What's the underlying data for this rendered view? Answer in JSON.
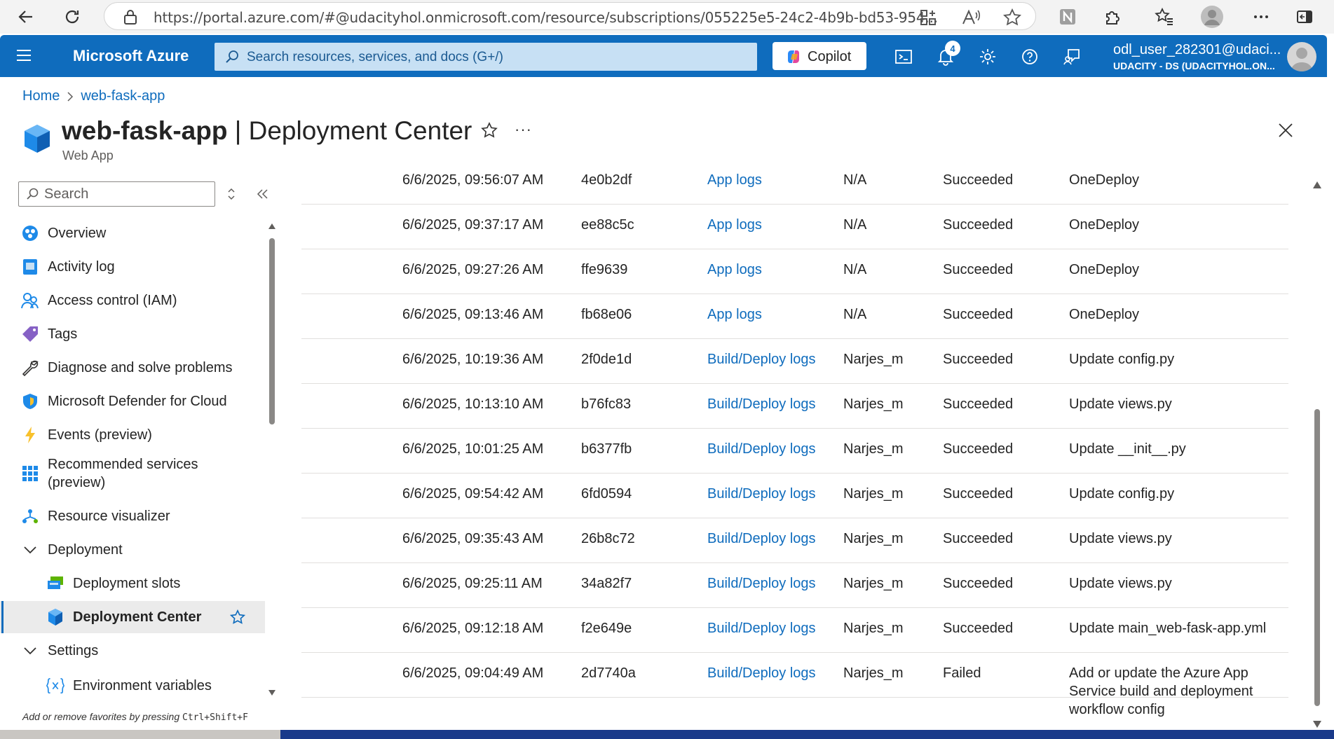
{
  "browser": {
    "url": "https://portal.azure.com/#@udacityhol.onmicrosoft.com/resource/subscriptions/055225e5-24c2-4b9b-bd53-954..."
  },
  "topbar": {
    "brand": "Microsoft Azure",
    "search_placeholder": "Search resources, services, and docs (G+/)",
    "copilot_label": "Copilot",
    "notification_count": "4",
    "user_name": "odl_user_282301@udaci...",
    "user_org": "UDACITY - DS (UDACITYHOL.ON..."
  },
  "breadcrumb": {
    "home": "Home",
    "resource": "web-fask-app"
  },
  "header": {
    "resource_name": "web-fask-app",
    "separator": " | ",
    "page_name": "Deployment Center",
    "subtitle": "Web App",
    "more": "···"
  },
  "sidebar": {
    "search_placeholder": "Search",
    "items": [
      {
        "label": "Overview",
        "icon": "overview-icon"
      },
      {
        "label": "Activity log",
        "icon": "activity-log-icon"
      },
      {
        "label": "Access control (IAM)",
        "icon": "iam-icon"
      },
      {
        "label": "Tags",
        "icon": "tag-icon"
      },
      {
        "label": "Diagnose and solve problems",
        "icon": "wrench-icon"
      },
      {
        "label": "Microsoft Defender for Cloud",
        "icon": "shield-icon"
      },
      {
        "label": "Events (preview)",
        "icon": "lightning-icon"
      },
      {
        "label": "Recommended services (preview)",
        "icon": "grid-icon"
      },
      {
        "label": "Resource visualizer",
        "icon": "visualizer-icon"
      },
      {
        "label": "Deployment",
        "icon": "chevron-down-icon"
      },
      {
        "label": "Deployment slots",
        "icon": "slots-icon"
      },
      {
        "label": "Deployment Center",
        "icon": "cube-icon"
      },
      {
        "label": "Settings",
        "icon": "chevron-down-icon"
      },
      {
        "label": "Environment variables",
        "icon": "variable-icon"
      }
    ],
    "fav_hint_prefix": "Add or remove favorites by pressing ",
    "fav_hint_keys": "Ctrl+Shift+F"
  },
  "deployments": [
    {
      "time": "6/6/2025, 09:56:07 AM",
      "commit": "4e0b2df",
      "logs": "App logs",
      "author": "N/A",
      "status": "Succeeded",
      "message": "OneDeploy"
    },
    {
      "time": "6/6/2025, 09:37:17 AM",
      "commit": "ee88c5c",
      "logs": "App logs",
      "author": "N/A",
      "status": "Succeeded",
      "message": "OneDeploy"
    },
    {
      "time": "6/6/2025, 09:27:26 AM",
      "commit": "ffe9639",
      "logs": "App logs",
      "author": "N/A",
      "status": "Succeeded",
      "message": "OneDeploy"
    },
    {
      "time": "6/6/2025, 09:13:46 AM",
      "commit": "fb68e06",
      "logs": "App logs",
      "author": "N/A",
      "status": "Succeeded",
      "message": "OneDeploy"
    },
    {
      "time": "6/6/2025, 10:19:36 AM",
      "commit": "2f0de1d",
      "logs": "Build/Deploy logs",
      "author": "Narjes_m",
      "status": "Succeeded",
      "message": "Update config.py"
    },
    {
      "time": "6/6/2025, 10:13:10 AM",
      "commit": "b76fc83",
      "logs": "Build/Deploy logs",
      "author": "Narjes_m",
      "status": "Succeeded",
      "message": "Update views.py"
    },
    {
      "time": "6/6/2025, 10:01:25 AM",
      "commit": "b6377fb",
      "logs": "Build/Deploy logs",
      "author": "Narjes_m",
      "status": "Succeeded",
      "message": "Update __init__.py"
    },
    {
      "time": "6/6/2025, 09:54:42 AM",
      "commit": "6fd0594",
      "logs": "Build/Deploy logs",
      "author": "Narjes_m",
      "status": "Succeeded",
      "message": "Update config.py"
    },
    {
      "time": "6/6/2025, 09:35:43 AM",
      "commit": "26b8c72",
      "logs": "Build/Deploy logs",
      "author": "Narjes_m",
      "status": "Succeeded",
      "message": "Update views.py"
    },
    {
      "time": "6/6/2025, 09:25:11 AM",
      "commit": "34a82f7",
      "logs": "Build/Deploy logs",
      "author": "Narjes_m",
      "status": "Succeeded",
      "message": "Update views.py"
    },
    {
      "time": "6/6/2025, 09:12:18 AM",
      "commit": "f2e649e",
      "logs": "Build/Deploy logs",
      "author": "Narjes_m",
      "status": "Succeeded",
      "message": "Update main_web-fask-app.yml"
    },
    {
      "time": "6/6/2025, 09:04:49 AM",
      "commit": "2d7740a",
      "logs": "Build/Deploy logs",
      "author": "Narjes_m",
      "status": "Failed",
      "message": "Add or update the Azure App Service build and deployment workflow config"
    }
  ],
  "colors": {
    "azure_blue": "#0f6cbd",
    "link": "#0f6cbd"
  }
}
